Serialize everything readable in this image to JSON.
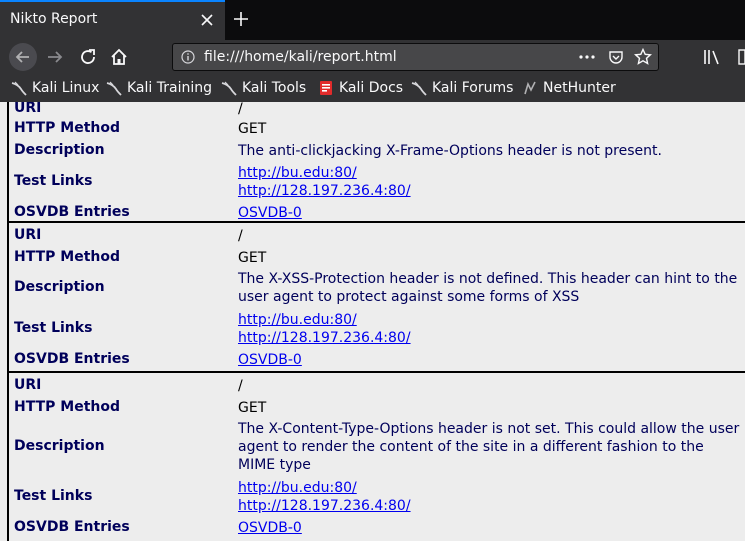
{
  "browser": {
    "tab_title": "Nikto Report",
    "url": "file:///home/kali/report.html"
  },
  "bookmarks": [
    {
      "label": "Kali Linux",
      "icon": "kali-dragon-icon"
    },
    {
      "label": "Kali Training",
      "icon": "kali-dragon-icon"
    },
    {
      "label": "Kali Tools",
      "icon": "kali-dragon-icon"
    },
    {
      "label": "Kali Docs",
      "icon": "kali-docs-icon"
    },
    {
      "label": "Kali Forums",
      "icon": "kali-dragon-icon"
    },
    {
      "label": "NetHunter",
      "icon": "nethunter-icon"
    }
  ],
  "labels": {
    "uri": "URI",
    "method": "HTTP Method",
    "description": "Description",
    "links": "Test Links",
    "osvdb": "OSVDB Entries"
  },
  "top_partial": {
    "uri": "/",
    "method": "GET",
    "description": "The anti-clickjacking X-Frame-Options header is not present.",
    "links": [
      "http://bu.edu:80/",
      "http://128.197.236.4:80/"
    ],
    "osvdb": "OSVDB-0"
  },
  "findings": [
    {
      "uri": "/",
      "method": "GET",
      "description": "The X-XSS-Protection header is not defined. This header can hint to the user agent to protect against some forms of XSS",
      "links": [
        "http://bu.edu:80/",
        "http://128.197.236.4:80/"
      ],
      "osvdb": "OSVDB-0"
    },
    {
      "uri": "/",
      "method": "GET",
      "description": "The X-Content-Type-Options header is not set. This could allow the user agent to render the content of the site in a different fashion to the MIME type",
      "links": [
        "http://bu.edu:80/",
        "http://128.197.236.4:80/"
      ],
      "osvdb": "OSVDB-0"
    }
  ]
}
